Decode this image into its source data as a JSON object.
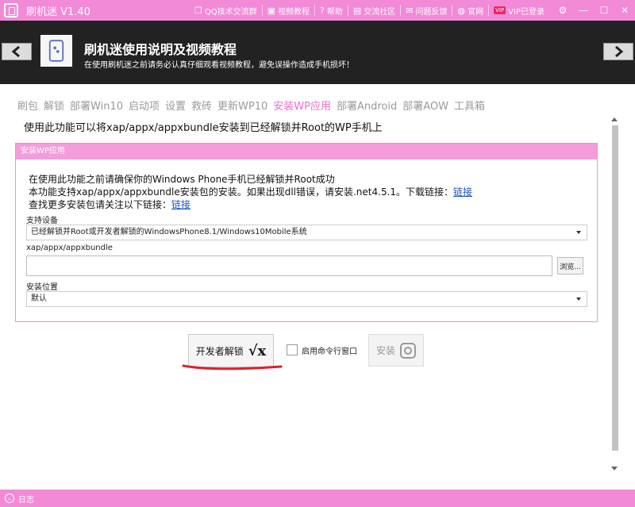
{
  "titlebar": {
    "app_title": "刷机迷 V1.40",
    "menu": [
      {
        "icon": "qq-icon",
        "glyph": "❐",
        "label": "QQ技术交流群"
      },
      {
        "icon": "video-icon",
        "glyph": "▣",
        "label": "视频教程"
      },
      {
        "icon": "help-icon",
        "glyph": "?",
        "label": "帮助"
      },
      {
        "icon": "community-icon",
        "glyph": "▤",
        "label": "交流社区"
      },
      {
        "icon": "feedback-icon",
        "glyph": "✉",
        "label": "问题反馈"
      },
      {
        "icon": "globe-icon",
        "glyph": "◍",
        "label": "官网"
      },
      {
        "icon": "vip-icon",
        "glyph": "VIP",
        "label": "VIP已登录"
      }
    ]
  },
  "banner": {
    "title": "刷机迷使用说明及视频教程",
    "subtitle": "在使用刷机迷之前请务必认真仔细观看视频教程，避免误操作造成手机损坏！"
  },
  "tabs": [
    "刷包",
    "解锁",
    "部署Win10",
    "启动项",
    "设置",
    "救砖",
    "更新WP10",
    "安装WP应用",
    "部署Android",
    "部署AOW",
    "工具箱"
  ],
  "active_tab": "安装WP应用",
  "description": "使用此功能可以将xap/appx/appxbundle安装到已经解锁并Root的WP手机上",
  "panel": {
    "header": "安装WP应用",
    "line1": "在使用此功能之前请确保你的Windows Phone手机已经解锁并Root成功",
    "line2": "本功能支持xap/appx/appxbundle安装包的安装。如果出现dll错误，请安装.net4.5.1。下载链接：",
    "line2_link": "链接",
    "line3": "查找更多安装包请关注以下链接：",
    "line3_link": "链接",
    "device_label": "支持设备",
    "device_value": "已经解锁并Root或开发者解锁的WindowsPhone8.1/Windows10Mobile系统",
    "file_label": "xap/appx/appxbundle",
    "file_value": "",
    "browse_label": "浏览...",
    "location_label": "安装位置",
    "location_value": "默认"
  },
  "actions": {
    "dev_unlock_label": "开发者解锁",
    "cmd_window_label": "启用命令行窗口",
    "cmd_window_checked": false,
    "install_label": "安装"
  },
  "logbar": {
    "label": "日志"
  },
  "colors": {
    "accent": "#f28ad8",
    "banner": "#222222",
    "active_tab": "#e96fcb",
    "annotation": "#e0202a"
  }
}
